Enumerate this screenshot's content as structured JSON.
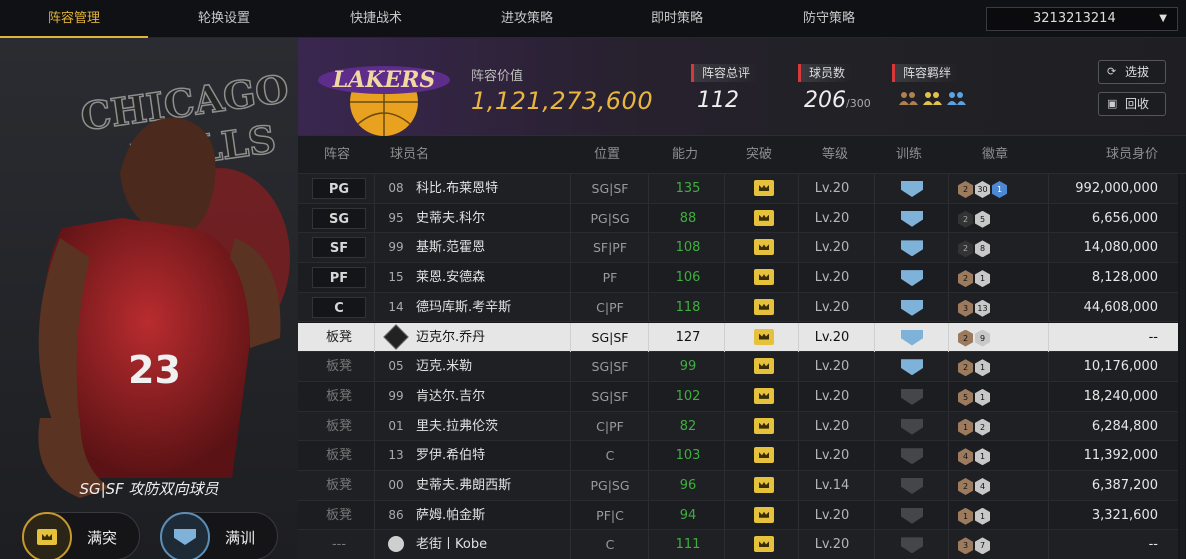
{
  "tabs": [
    "阵容管理",
    "轮换设置",
    "快捷战术",
    "进攻策略",
    "即时策略",
    "防守策略"
  ],
  "active_tab": "阵容管理",
  "account": {
    "id": "3213213214"
  },
  "player_panel": {
    "team_logo_text": "CHICAGO BULLS",
    "jersey_number": "23",
    "description": "SG|SF 攻防双向球员",
    "break_label": "满突",
    "train_label": "满训"
  },
  "team_header": {
    "logo_text": "LAKERS",
    "value_label": "阵容价值",
    "value": "1,121,273,600",
    "total_rating_label": "阵容总评",
    "total_rating": "112",
    "players_label": "球员数",
    "players_count": "206",
    "players_max": "/300",
    "bond_label": "阵容羁绊",
    "buttons": {
      "draft": "选拔",
      "recycle": "回收"
    }
  },
  "table": {
    "headers": [
      "阵容",
      "球员名",
      "位置",
      "能力",
      "突破",
      "等级",
      "训练",
      "徽章",
      "球员身价"
    ],
    "rows": [
      {
        "slot": "PG",
        "num": "08",
        "name": "科比.布莱恩特",
        "position": "SG|SF",
        "ability": "135",
        "level": "Lv.20",
        "train": "blue",
        "badges": [
          [
            "br",
            "2"
          ],
          [
            "sv",
            "30"
          ],
          [
            "bl",
            "1"
          ]
        ],
        "price": "992,000,000"
      },
      {
        "slot": "SG",
        "num": "95",
        "name": "史蒂夫.科尔",
        "position": "PG|SG",
        "ability": "88",
        "level": "Lv.20",
        "train": "blue",
        "badges": [
          [
            "dk",
            "2"
          ],
          [
            "sv",
            "5"
          ]
        ],
        "price": "6,656,000"
      },
      {
        "slot": "SF",
        "num": "99",
        "name": "基斯.范霍恩",
        "position": "SF|PF",
        "ability": "108",
        "level": "Lv.20",
        "train": "blue",
        "badges": [
          [
            "dk",
            "2"
          ],
          [
            "sv",
            "8"
          ]
        ],
        "price": "14,080,000"
      },
      {
        "slot": "PF",
        "num": "15",
        "name": "莱恩.安德森",
        "position": "PF",
        "ability": "106",
        "level": "Lv.20",
        "train": "blue",
        "badges": [
          [
            "br",
            "2"
          ],
          [
            "sv",
            "1"
          ]
        ],
        "price": "8,128,000"
      },
      {
        "slot": "C",
        "num": "14",
        "name": "德玛库斯.考辛斯",
        "position": "C|PF",
        "ability": "118",
        "level": "Lv.20",
        "train": "blue",
        "badges": [
          [
            "br",
            "3"
          ],
          [
            "sv",
            "13"
          ]
        ],
        "price": "44,608,000"
      },
      {
        "slot": "板凳",
        "num": "COPY",
        "name": "迈克尔.乔丹",
        "position": "SG|SF",
        "ability": "127",
        "level": "Lv.20",
        "train": "blue",
        "badges": [
          [
            "br",
            "2"
          ],
          [
            "sv",
            "9"
          ]
        ],
        "price": "--"
      },
      {
        "slot": "板凳",
        "num": "05",
        "name": "迈克.米勒",
        "position": "SG|SF",
        "ability": "99",
        "level": "Lv.20",
        "train": "blue3",
        "badges": [
          [
            "br",
            "2"
          ],
          [
            "sv",
            "1"
          ]
        ],
        "price": "10,176,000"
      },
      {
        "slot": "板凳",
        "num": "99",
        "name": "肯达尔.吉尔",
        "position": "SG|SF",
        "ability": "102",
        "level": "Lv.20",
        "train": "grey",
        "badges": [
          [
            "br",
            "5"
          ],
          [
            "sv",
            "1"
          ]
        ],
        "price": "18,240,000"
      },
      {
        "slot": "板凳",
        "num": "01",
        "name": "里夫.拉弗伦茨",
        "position": "C|PF",
        "ability": "82",
        "level": "Lv.20",
        "train": "grey",
        "badges": [
          [
            "br",
            "1"
          ],
          [
            "sv",
            "2"
          ]
        ],
        "price": "6,284,800"
      },
      {
        "slot": "板凳",
        "num": "13",
        "name": "罗伊.希伯特",
        "position": "C",
        "ability": "103",
        "level": "Lv.20",
        "train": "grey",
        "badges": [
          [
            "br",
            "4"
          ],
          [
            "sv",
            "1"
          ]
        ],
        "price": "11,392,000"
      },
      {
        "slot": "板凳",
        "num": "00",
        "name": "史蒂夫.弗朗西斯",
        "position": "PG|SG",
        "ability": "96",
        "level": "Lv.14",
        "train": "grey",
        "badges": [
          [
            "br",
            "2"
          ],
          [
            "sv",
            "4"
          ]
        ],
        "price": "6,387,200"
      },
      {
        "slot": "板凳",
        "num": "86",
        "name": "萨姆.帕金斯",
        "position": "PF|C",
        "ability": "94",
        "level": "Lv.20",
        "train": "grey",
        "badges": [
          [
            "br",
            "1"
          ],
          [
            "sv",
            "1"
          ]
        ],
        "price": "3,321,600"
      },
      {
        "slot": "---",
        "num": "AV",
        "name": "老街丨Kobe",
        "position": "C",
        "ability": "111",
        "level": "Lv.20",
        "train": "grey",
        "badges": [
          [
            "br",
            "3"
          ],
          [
            "sv",
            "7"
          ]
        ],
        "price": "--"
      }
    ],
    "selected_index": 5
  },
  "colors": {
    "accent": "#e2b33a",
    "ability_green": "#3fae3f",
    "red_marker": "#d9383a"
  }
}
